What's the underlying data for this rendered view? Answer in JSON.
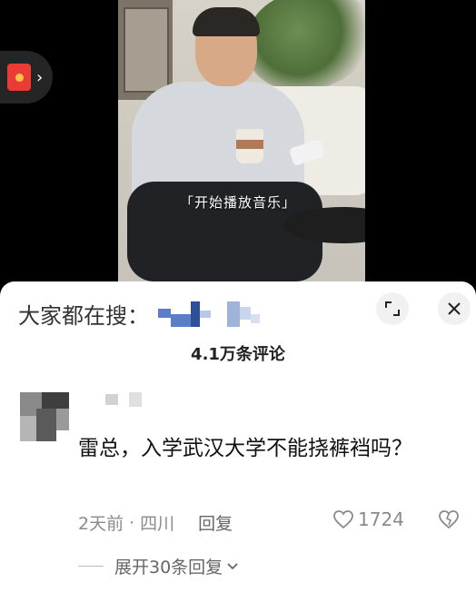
{
  "video": {
    "caption": "「开始播放音乐」"
  },
  "sheet": {
    "search_label": "大家都在搜：",
    "comment_count": "4.1万条评论"
  },
  "comment": {
    "text": "雷总，入学武汉大学不能挠裤裆吗？",
    "time": "2天前",
    "separator": "·",
    "location": "四川",
    "reply_label": "回复",
    "likes": "1724",
    "expand_label": "展开30条回复"
  },
  "icons": {
    "red_packet": "red-envelope-icon",
    "expand": "expand-corners-icon",
    "close": "close-icon",
    "like": "heart-icon",
    "dislike": "broken-heart-icon"
  },
  "colors": {
    "red_packet": "#ea3b35",
    "text_primary": "#111111",
    "text_secondary": "#8a8a8a"
  }
}
